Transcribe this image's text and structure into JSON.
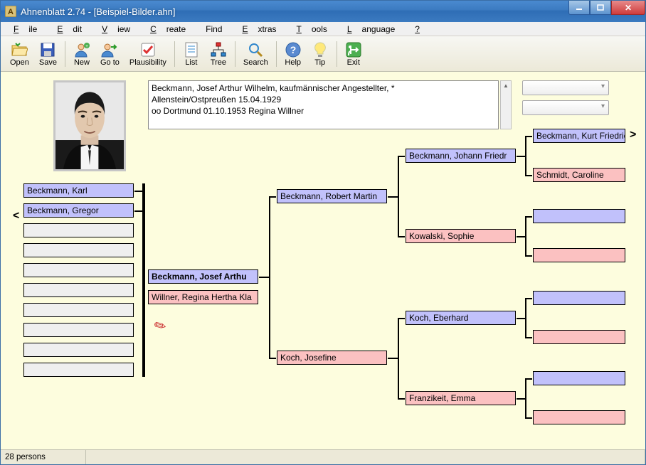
{
  "window": {
    "title": "Ahnenblatt 2.74 - [Beispiel-Bilder.ahn]"
  },
  "menu": {
    "file": "File",
    "edit": "Edit",
    "view": "View",
    "create": "Create",
    "find": "Find",
    "extras": "Extras",
    "tools": "Tools",
    "language": "Language",
    "help": "?"
  },
  "toolbar": {
    "open": "Open",
    "save": "Save",
    "new": "New",
    "goto": "Go to",
    "plausibility": "Plausibility",
    "list": "List",
    "tree": "Tree",
    "search": "Search",
    "help": "Help",
    "tip": "Tip",
    "exit": "Exit"
  },
  "info_text": "Beckmann, Josef Arthur Wilhelm, kaufmännischer Angestellter, *\nAllenstein/Ostpreußen 15.04.1929\noo Dortmund 01.10.1953 Regina Willner",
  "children_header": "",
  "children": [
    "Beckmann, Karl",
    "Beckmann, Gregor"
  ],
  "focus_person": "Beckmann, Josef Arthu",
  "spouse": "Willner, Regina Hertha Kla",
  "gen2": {
    "father": "Beckmann, Robert Martin",
    "mother": "Koch, Josefine"
  },
  "gen3": {
    "ff": "Beckmann, Johann Friedr",
    "fm": "Kowalski, Sophie",
    "mf": "Koch, Eberhard",
    "mm": "Franzikeit, Emma"
  },
  "gen4": {
    "fff": "Beckmann, Kurt Friedrich",
    "ffm": "Schmidt, Caroline"
  },
  "status": {
    "persons": "28 persons"
  }
}
